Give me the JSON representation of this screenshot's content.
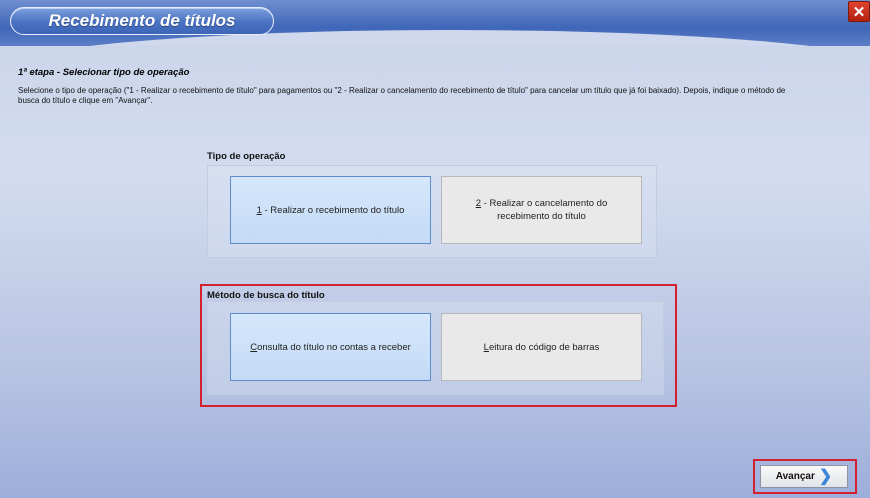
{
  "window": {
    "title": "Recebimento de títulos",
    "close_label": "✕"
  },
  "step": {
    "title": "1ª etapa - Selecionar tipo de operação",
    "instructions": "Selecione o tipo de operação (\"1 - Realizar o recebimento de título\" para pagamentos ou \"2 - Realizar o cancelamento do recebimento de título\" para cancelar um título que já foi baixado). Depois, indique o método de busca do título e clique em \"Avançar\"."
  },
  "operation_group": {
    "label": "Tipo de operação",
    "options": [
      {
        "key": "1",
        "rest": " - Realizar o recebimento do título",
        "selected": true
      },
      {
        "key": "2",
        "rest": " - Realizar o cancelamento do recebimento do título",
        "selected": false
      }
    ]
  },
  "search_group": {
    "label": "Método de busca do título",
    "options": [
      {
        "key": "C",
        "rest": "onsulta do título no contas a receber",
        "selected": true
      },
      {
        "key": "L",
        "rest": "eitura do código de barras",
        "selected": false
      }
    ]
  },
  "footer": {
    "next_label": "Avançar",
    "next_icon": "chevron-right-icon"
  },
  "colors": {
    "highlight": "#d4212f",
    "selected_border": "#5d8dcc",
    "title_bar": "#3f66b8"
  }
}
